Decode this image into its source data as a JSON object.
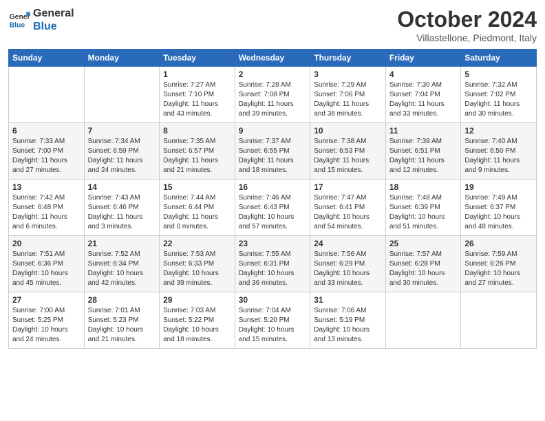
{
  "header": {
    "logo_line1": "General",
    "logo_line2": "Blue",
    "month": "October 2024",
    "location": "Villastellone, Piedmont, Italy"
  },
  "days_of_week": [
    "Sunday",
    "Monday",
    "Tuesday",
    "Wednesday",
    "Thursday",
    "Friday",
    "Saturday"
  ],
  "weeks": [
    [
      {
        "day": "",
        "detail": ""
      },
      {
        "day": "",
        "detail": ""
      },
      {
        "day": "1",
        "detail": "Sunrise: 7:27 AM\nSunset: 7:10 PM\nDaylight: 11 hours and 43 minutes."
      },
      {
        "day": "2",
        "detail": "Sunrise: 7:28 AM\nSunset: 7:08 PM\nDaylight: 11 hours and 39 minutes."
      },
      {
        "day": "3",
        "detail": "Sunrise: 7:29 AM\nSunset: 7:06 PM\nDaylight: 11 hours and 36 minutes."
      },
      {
        "day": "4",
        "detail": "Sunrise: 7:30 AM\nSunset: 7:04 PM\nDaylight: 11 hours and 33 minutes."
      },
      {
        "day": "5",
        "detail": "Sunrise: 7:32 AM\nSunset: 7:02 PM\nDaylight: 11 hours and 30 minutes."
      }
    ],
    [
      {
        "day": "6",
        "detail": "Sunrise: 7:33 AM\nSunset: 7:00 PM\nDaylight: 11 hours and 27 minutes."
      },
      {
        "day": "7",
        "detail": "Sunrise: 7:34 AM\nSunset: 6:59 PM\nDaylight: 11 hours and 24 minutes."
      },
      {
        "day": "8",
        "detail": "Sunrise: 7:35 AM\nSunset: 6:57 PM\nDaylight: 11 hours and 21 minutes."
      },
      {
        "day": "9",
        "detail": "Sunrise: 7:37 AM\nSunset: 6:55 PM\nDaylight: 11 hours and 18 minutes."
      },
      {
        "day": "10",
        "detail": "Sunrise: 7:38 AM\nSunset: 6:53 PM\nDaylight: 11 hours and 15 minutes."
      },
      {
        "day": "11",
        "detail": "Sunrise: 7:39 AM\nSunset: 6:51 PM\nDaylight: 11 hours and 12 minutes."
      },
      {
        "day": "12",
        "detail": "Sunrise: 7:40 AM\nSunset: 6:50 PM\nDaylight: 11 hours and 9 minutes."
      }
    ],
    [
      {
        "day": "13",
        "detail": "Sunrise: 7:42 AM\nSunset: 6:48 PM\nDaylight: 11 hours and 6 minutes."
      },
      {
        "day": "14",
        "detail": "Sunrise: 7:43 AM\nSunset: 6:46 PM\nDaylight: 11 hours and 3 minutes."
      },
      {
        "day": "15",
        "detail": "Sunrise: 7:44 AM\nSunset: 6:44 PM\nDaylight: 11 hours and 0 minutes."
      },
      {
        "day": "16",
        "detail": "Sunrise: 7:46 AM\nSunset: 6:43 PM\nDaylight: 10 hours and 57 minutes."
      },
      {
        "day": "17",
        "detail": "Sunrise: 7:47 AM\nSunset: 6:41 PM\nDaylight: 10 hours and 54 minutes."
      },
      {
        "day": "18",
        "detail": "Sunrise: 7:48 AM\nSunset: 6:39 PM\nDaylight: 10 hours and 51 minutes."
      },
      {
        "day": "19",
        "detail": "Sunrise: 7:49 AM\nSunset: 6:37 PM\nDaylight: 10 hours and 48 minutes."
      }
    ],
    [
      {
        "day": "20",
        "detail": "Sunrise: 7:51 AM\nSunset: 6:36 PM\nDaylight: 10 hours and 45 minutes."
      },
      {
        "day": "21",
        "detail": "Sunrise: 7:52 AM\nSunset: 6:34 PM\nDaylight: 10 hours and 42 minutes."
      },
      {
        "day": "22",
        "detail": "Sunrise: 7:53 AM\nSunset: 6:33 PM\nDaylight: 10 hours and 39 minutes."
      },
      {
        "day": "23",
        "detail": "Sunrise: 7:55 AM\nSunset: 6:31 PM\nDaylight: 10 hours and 36 minutes."
      },
      {
        "day": "24",
        "detail": "Sunrise: 7:56 AM\nSunset: 6:29 PM\nDaylight: 10 hours and 33 minutes."
      },
      {
        "day": "25",
        "detail": "Sunrise: 7:57 AM\nSunset: 6:28 PM\nDaylight: 10 hours and 30 minutes."
      },
      {
        "day": "26",
        "detail": "Sunrise: 7:59 AM\nSunset: 6:26 PM\nDaylight: 10 hours and 27 minutes."
      }
    ],
    [
      {
        "day": "27",
        "detail": "Sunrise: 7:00 AM\nSunset: 5:25 PM\nDaylight: 10 hours and 24 minutes."
      },
      {
        "day": "28",
        "detail": "Sunrise: 7:01 AM\nSunset: 5:23 PM\nDaylight: 10 hours and 21 minutes."
      },
      {
        "day": "29",
        "detail": "Sunrise: 7:03 AM\nSunset: 5:22 PM\nDaylight: 10 hours and 18 minutes."
      },
      {
        "day": "30",
        "detail": "Sunrise: 7:04 AM\nSunset: 5:20 PM\nDaylight: 10 hours and 15 minutes."
      },
      {
        "day": "31",
        "detail": "Sunrise: 7:06 AM\nSunset: 5:19 PM\nDaylight: 10 hours and 13 minutes."
      },
      {
        "day": "",
        "detail": ""
      },
      {
        "day": "",
        "detail": ""
      }
    ]
  ]
}
